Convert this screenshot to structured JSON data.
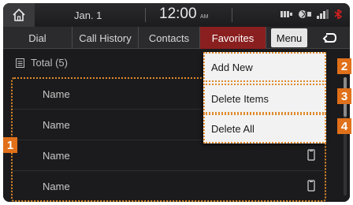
{
  "statusbar": {
    "date": "Jan.  1",
    "time": "12:00",
    "ampm": "AM"
  },
  "tabs": {
    "dial": "Dial",
    "call_history": "Call History",
    "contacts": "Contacts",
    "favorites": "Favorites",
    "menu": "Menu"
  },
  "list": {
    "total_label": "Total (5)",
    "rows": [
      {
        "name": "Name"
      },
      {
        "name": "Name"
      },
      {
        "name": "Name"
      },
      {
        "name": "Name"
      }
    ]
  },
  "menu": {
    "add_new": "Add New",
    "delete_items": "Delete Items",
    "delete_all": "Delete All"
  },
  "callouts": [
    "1",
    "2",
    "3",
    "4"
  ],
  "colors": {
    "accent_active_tab": "#8a1f1f",
    "callout": "#e0701a",
    "highlight_border": "#e08a2c",
    "bluetooth_indicator": "#d02020"
  }
}
